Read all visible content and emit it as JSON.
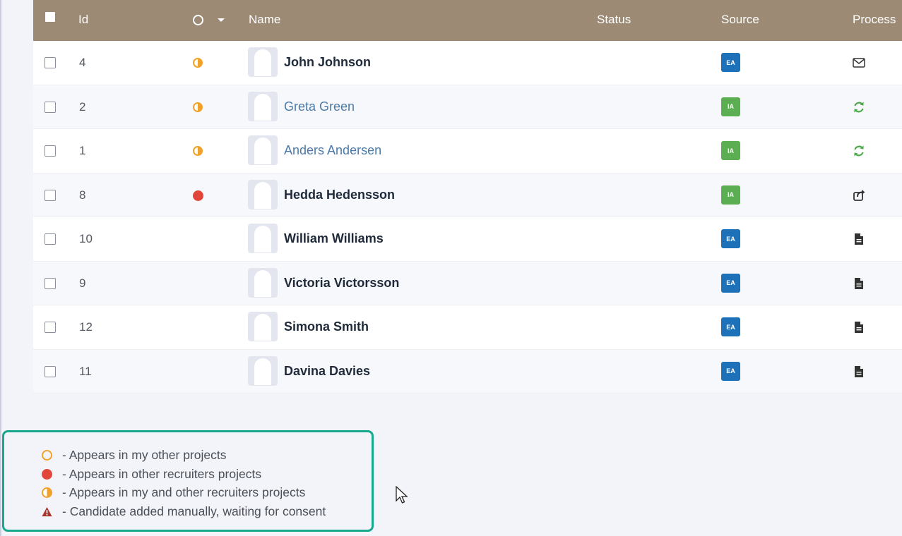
{
  "table": {
    "columns": {
      "id": "Id",
      "name": "Name",
      "status": "Status",
      "source": "Source",
      "process": "Process"
    },
    "rows": [
      {
        "id": "4",
        "marker": "half",
        "name": "John Johnson",
        "name_style": "bold",
        "source": "EA",
        "process_icon": "envelope-icon"
      },
      {
        "id": "2",
        "marker": "half",
        "name": "Greta Green",
        "name_style": "link",
        "source": "IA",
        "process_icon": "refresh-icon"
      },
      {
        "id": "1",
        "marker": "half",
        "name": "Anders Andersen",
        "name_style": "link",
        "source": "IA",
        "process_icon": "refresh-icon"
      },
      {
        "id": "8",
        "marker": "red",
        "name": "Hedda Hedensson",
        "name_style": "bold",
        "source": "IA",
        "process_icon": "share-icon"
      },
      {
        "id": "10",
        "marker": "",
        "name": "William Williams",
        "name_style": "bold",
        "source": "EA",
        "process_icon": "document-icon"
      },
      {
        "id": "9",
        "marker": "",
        "name": "Victoria Victorsson",
        "name_style": "bold",
        "source": "EA",
        "process_icon": "document-icon"
      },
      {
        "id": "12",
        "marker": "",
        "name": "Simona Smith",
        "name_style": "bold",
        "source": "EA",
        "process_icon": "document-icon"
      },
      {
        "id": "11",
        "marker": "",
        "name": "Davina Davies",
        "name_style": "bold",
        "source": "EA",
        "process_icon": "document-icon"
      }
    ]
  },
  "legend": {
    "items": [
      {
        "icon": "hollow-circle-icon",
        "text": "- Appears in my other projects"
      },
      {
        "icon": "red-dot-icon",
        "text": "- Appears in other recruiters projects"
      },
      {
        "icon": "half-circle-icon",
        "text": "- Appears in my and other recruiters projects"
      },
      {
        "icon": "warning-icon",
        "text": "- Candidate added manually, waiting for consent"
      }
    ]
  },
  "colors": {
    "header_bg": "#9c8a74",
    "accent_orange": "#f0a22a",
    "accent_red": "#e2463a",
    "badge_ea": "#1d71b8",
    "badge_ia": "#5cae52",
    "legend_border": "#17a88e",
    "link": "#4a7aa9"
  }
}
